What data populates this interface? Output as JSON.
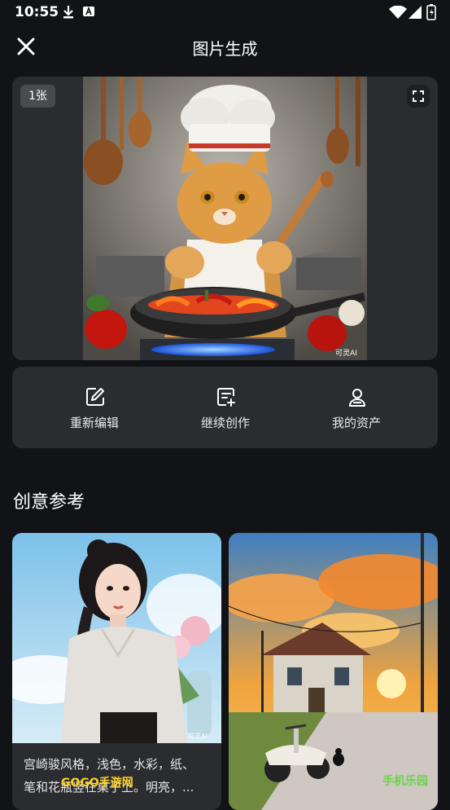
{
  "status": {
    "time": "10:55"
  },
  "header": {
    "title": "图片生成"
  },
  "hero": {
    "count_badge": "1张",
    "watermark": "可灵AI"
  },
  "actions": [
    {
      "label": "重新编辑",
      "icon": "edit-icon"
    },
    {
      "label": "继续创作",
      "icon": "add-document-icon"
    },
    {
      "label": "我的资产",
      "icon": "user-icon"
    }
  ],
  "section": {
    "title": "创意参考"
  },
  "cards": [
    {
      "caption_line1": "宫崎骏风格，浅色，水彩，纸、",
      "caption_line2": "笔和花瓶竖在桌子上。明亮，..."
    },
    {
      "caption_line1": "",
      "caption_line2": ""
    }
  ],
  "watermarks": {
    "left": "GOGO手游网",
    "right": "手机乐园"
  },
  "colors": {
    "background": "#121316",
    "panel": "#2b2c30",
    "text": "#f2f2f2"
  }
}
